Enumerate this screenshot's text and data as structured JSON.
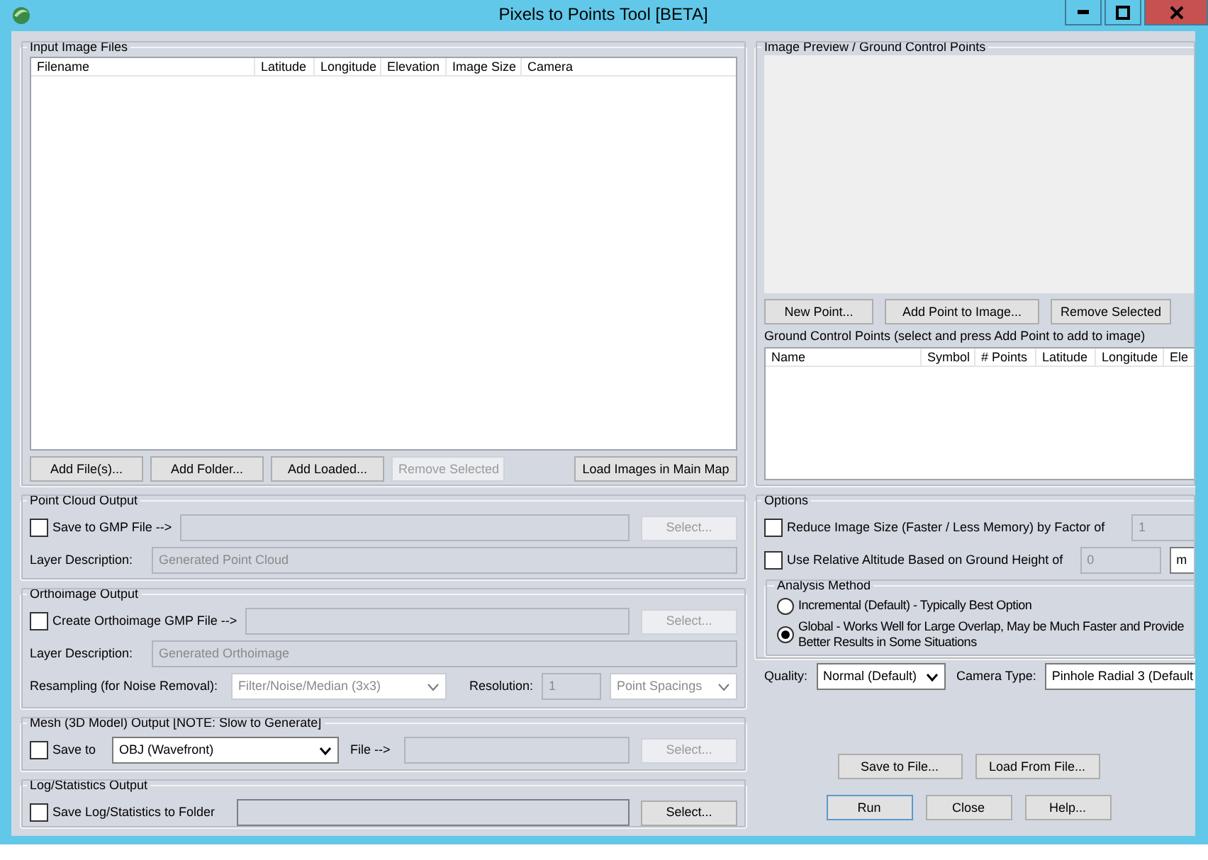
{
  "window": {
    "title": "Pixels to Points Tool [BETA]"
  },
  "input_files": {
    "title": "Input Image Files",
    "columns": [
      "Filename",
      "Latitude",
      "Longitude",
      "Elevation",
      "Image Size",
      "Camera"
    ],
    "buttons": [
      {
        "label": "Add File(s)...",
        "disabled": false
      },
      {
        "label": "Add Folder...",
        "disabled": false
      },
      {
        "label": "Add Loaded...",
        "disabled": false
      },
      {
        "label": "Remove Selected",
        "disabled": true
      }
    ],
    "map_button": {
      "label": "Load Images in Main Map",
      "disabled": false
    }
  },
  "point_cloud": {
    "title": "Point Cloud Output",
    "checkbox": {
      "label": "Save to GMP File -->",
      "checked": false
    },
    "select_button": {
      "label": "Select...",
      "disabled": true
    },
    "layer_label": "Layer Description:",
    "layer_field": {
      "value": "Generated Point Cloud",
      "disabled": true
    }
  },
  "orthoimage": {
    "title": "Orthoimage Output",
    "checkbox": {
      "label": "Create Orthoimage GMP File -->",
      "checked": false
    },
    "select_button": {
      "label": "Select...",
      "disabled": true
    },
    "layer_label": "Layer Description:",
    "layer_field": {
      "value": "Generated Orthoimage",
      "disabled": true
    },
    "resampling_label": "Resampling (for Noise Removal):",
    "resampling": {
      "value": "Filter/Noise/Median (3x3)",
      "disabled": true
    },
    "resolution_label": "Resolution:",
    "resolution_field": {
      "value": "1",
      "disabled": true
    },
    "resolution_unit": {
      "value": "Point Spacings",
      "disabled": true
    }
  },
  "mesh": {
    "title": "Mesh (3D Model) Output [NOTE: Slow to Generate]",
    "checkbox": {
      "label": "Save to",
      "checked": false
    },
    "format": {
      "value": "OBJ (Wavefront)",
      "disabled": false
    },
    "file_label": "File -->",
    "select_button": {
      "label": "Select...",
      "disabled": true
    }
  },
  "log": {
    "title": "Log/Statistics Output",
    "checkbox": {
      "label": "Save Log/Statistics to Folder",
      "checked": false
    },
    "select_button": {
      "label": "Select...",
      "disabled": false
    }
  },
  "preview": {
    "title": "Image Preview / Ground Control Points",
    "buttons": [
      {
        "label": "New Point...",
        "disabled": false
      },
      {
        "label": "Add Point to Image...",
        "disabled": false
      },
      {
        "label": "Remove Selected",
        "disabled": false
      }
    ],
    "gcp_label": "Ground Control Points (select and press Add Point to add to image)",
    "columns": [
      "Name",
      "Symbol",
      "# Points",
      "Latitude",
      "Longitude",
      "Ele"
    ]
  },
  "options": {
    "title": "Options",
    "reduce": {
      "label": "Reduce Image Size (Faster / Less Memory) by Factor of",
      "checked": false,
      "value": "1"
    },
    "altitude": {
      "label": "Use Relative Altitude Based on Ground Height of",
      "checked": false,
      "value": "0",
      "unit": "m"
    },
    "analysis": {
      "title": "Analysis Method",
      "radios": [
        {
          "lines": [
            "Incremental (Default) - Typically Best Option"
          ],
          "selected": false
        },
        {
          "lines": [
            "Global - Works Well for Large Overlap, May be Much Faster and Provide",
            "Better Results in Some Situations"
          ],
          "selected": true
        }
      ]
    },
    "quality_label": "Quality:",
    "quality": {
      "value": "Normal (Default)",
      "disabled": false
    },
    "camera_label": "Camera Type:",
    "camera": {
      "value": "Pinhole Radial 3 (Default",
      "disabled": false
    }
  },
  "footer": {
    "row1": [
      {
        "label": "Save to File...",
        "disabled": false
      },
      {
        "label": "Load From File...",
        "disabled": false
      }
    ],
    "row2": [
      {
        "label": "Run",
        "disabled": false
      },
      {
        "label": "Close",
        "disabled": false
      },
      {
        "label": "Help...",
        "disabled": false
      }
    ]
  }
}
